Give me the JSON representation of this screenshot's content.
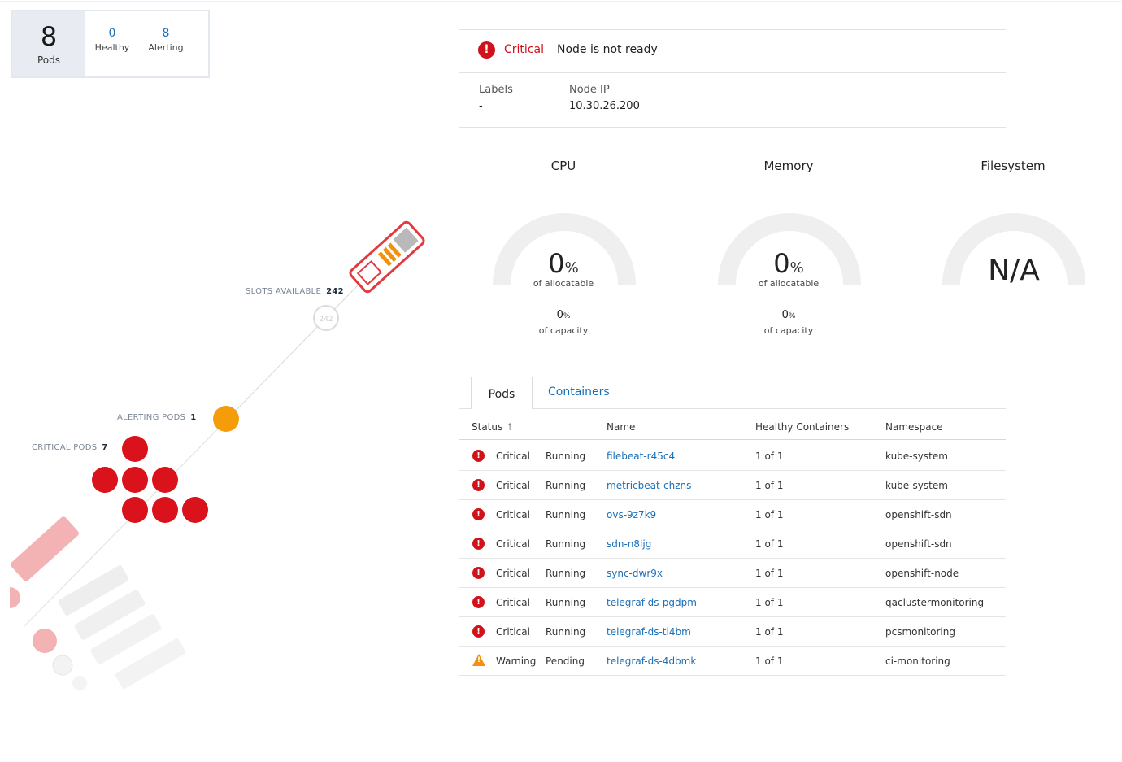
{
  "summary": {
    "pods_count": "8",
    "pods_label": "Pods",
    "healthy_count": "0",
    "healthy_label": "Healthy",
    "alerting_count": "8",
    "alerting_label": "Alerting"
  },
  "node": {
    "status": "Critical",
    "message": "Node is not ready",
    "labels_label": "Labels",
    "labels_value": "-",
    "ip_label": "Node IP",
    "ip_value": "10.30.26.200"
  },
  "gauges": {
    "cpu": {
      "title": "CPU",
      "value": "0",
      "unit": "%",
      "sub": "of allocatable",
      "capacity_value": "0",
      "capacity_unit": "%",
      "capacity_label": "of capacity"
    },
    "memory": {
      "title": "Memory",
      "value": "0",
      "unit": "%",
      "sub": "of allocatable",
      "capacity_value": "0",
      "capacity_unit": "%",
      "capacity_label": "of capacity"
    },
    "filesystem": {
      "title": "Filesystem",
      "value": "N/A"
    }
  },
  "tabs": [
    {
      "label": "Pods",
      "active": true
    },
    {
      "label": "Containers",
      "active": false
    }
  ],
  "table": {
    "headers": {
      "status": "Status",
      "sort_icon": "↑",
      "name": "Name",
      "healthy": "Healthy Containers",
      "namespace": "Namespace"
    },
    "rows": [
      {
        "status": "Critical",
        "phase": "Running",
        "name": "filebeat-r45c4",
        "healthy": "1 of 1",
        "namespace": "kube-system"
      },
      {
        "status": "Critical",
        "phase": "Running",
        "name": "metricbeat-chzns",
        "healthy": "1 of 1",
        "namespace": "kube-system"
      },
      {
        "status": "Critical",
        "phase": "Running",
        "name": "ovs-9z7k9",
        "healthy": "1 of 1",
        "namespace": "openshift-sdn"
      },
      {
        "status": "Critical",
        "phase": "Running",
        "name": "sdn-n8ljg",
        "healthy": "1 of 1",
        "namespace": "openshift-sdn"
      },
      {
        "status": "Critical",
        "phase": "Running",
        "name": "sync-dwr9x",
        "healthy": "1 of 1",
        "namespace": "openshift-node"
      },
      {
        "status": "Critical",
        "phase": "Running",
        "name": "telegraf-ds-pgdpm",
        "healthy": "1 of 1",
        "namespace": "qaclustermonitoring"
      },
      {
        "status": "Critical",
        "phase": "Running",
        "name": "telegraf-ds-tl4bm",
        "healthy": "1 of 1",
        "namespace": "pcsmonitoring"
      },
      {
        "status": "Warning",
        "phase": "Pending",
        "name": "telegraf-ds-4dbmk",
        "healthy": "1 of 1",
        "namespace": "ci-monitoring"
      }
    ]
  },
  "topology": {
    "slots_label": "SLOTS AVAILABLE",
    "slots_value": "242",
    "alerting_label": "ALERTING PODS",
    "alerting_value": "1",
    "critical_label": "CRITICAL PODS",
    "critical_value": "7"
  },
  "colors": {
    "critical": "#d0121b",
    "warning": "#f29111",
    "link": "#1a6fb8",
    "gauge_track": "#efefef"
  }
}
